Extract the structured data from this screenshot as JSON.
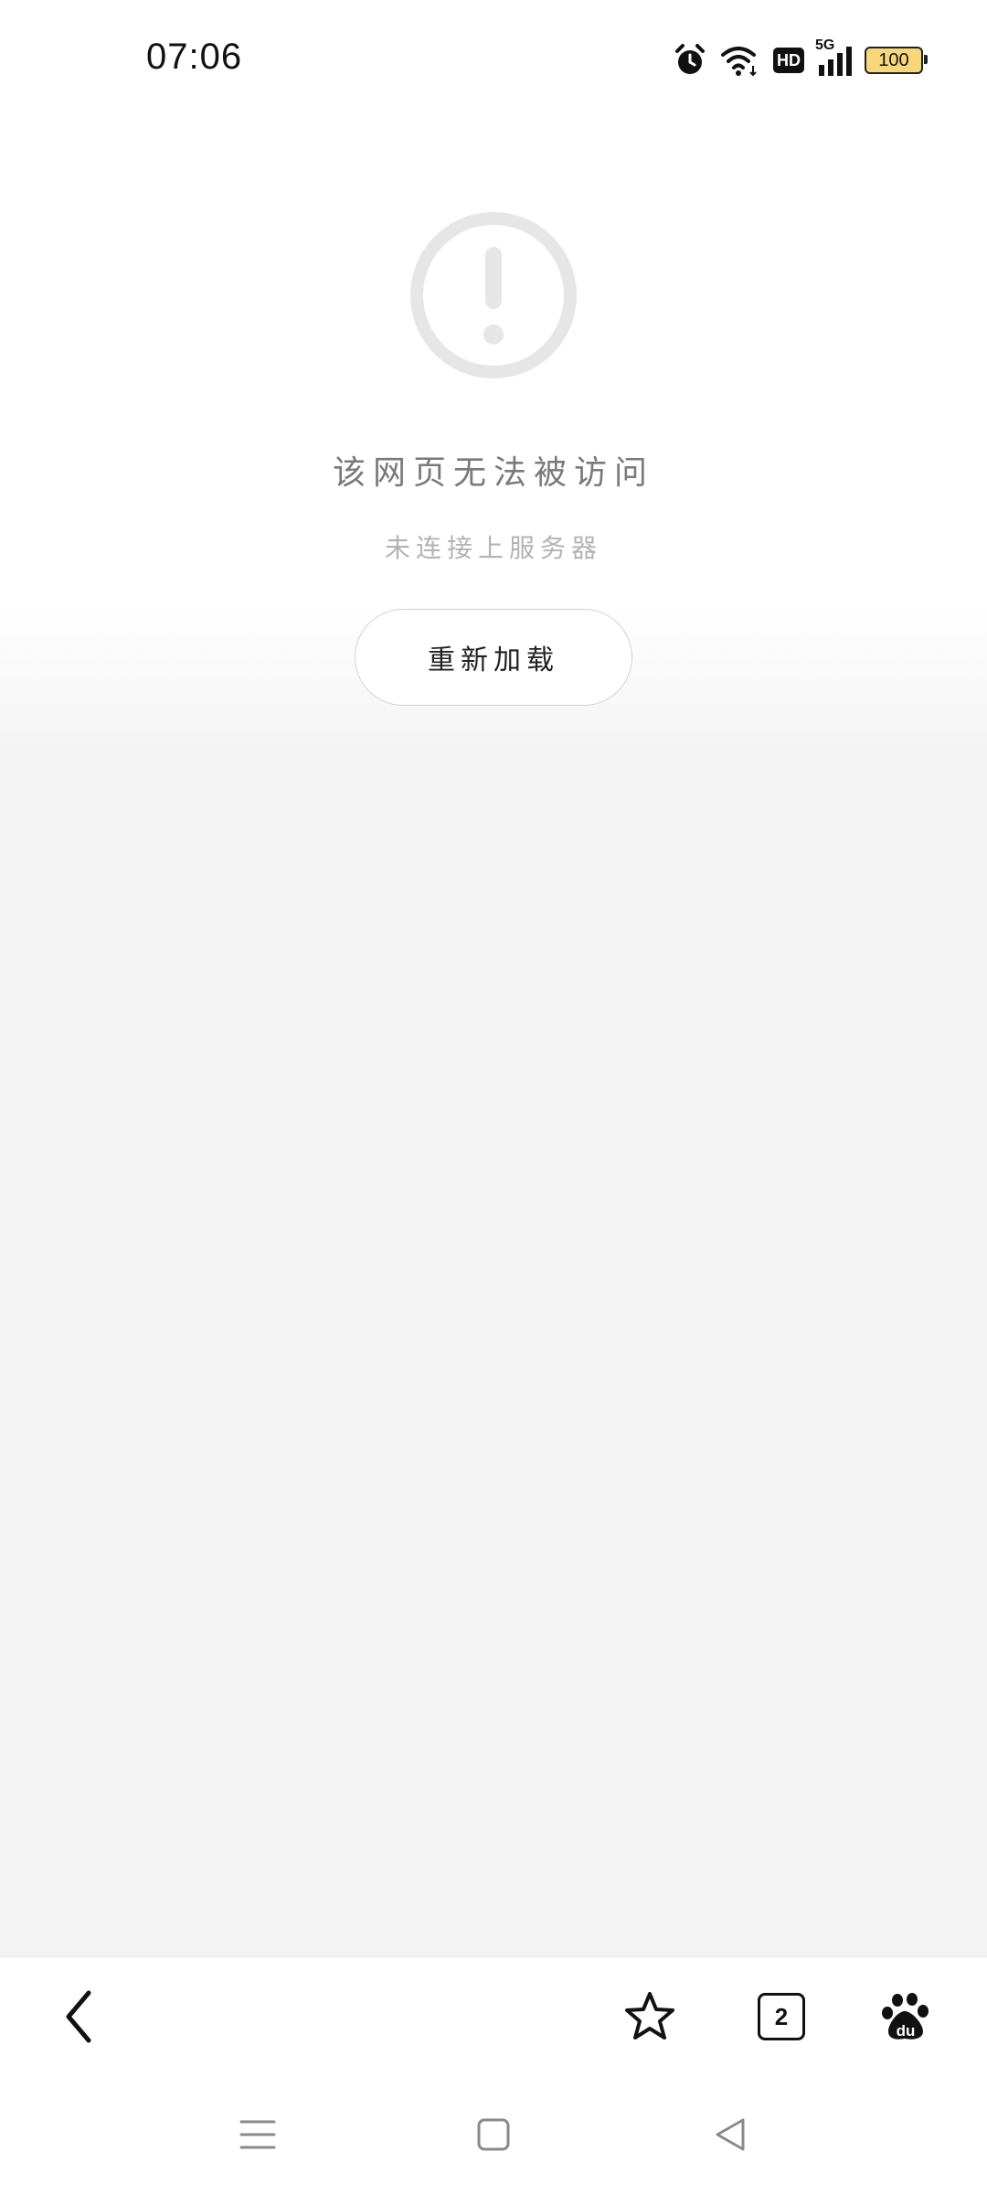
{
  "status_bar": {
    "time": "07:06",
    "icons": [
      "alarm-icon",
      "wifi-icon",
      "hd-icon",
      "5g-signal-icon",
      "battery-icon"
    ],
    "hd_label": "HD",
    "network_label": "5G",
    "battery_level": "100"
  },
  "error_page": {
    "icon": "exclamation-circle-icon",
    "title": "该网页无法被访问",
    "subtitle": "未连接上服务器",
    "reload_label": "重新加载"
  },
  "toolbar": {
    "back_icon": "back-chevron-icon",
    "bookmark_icon": "star-icon",
    "tab_count": "2",
    "baidu_icon": "baidu-paw-icon"
  },
  "nav_bar": {
    "icons": [
      "menu-icon",
      "home-icon",
      "back-triangle-icon"
    ]
  },
  "colors": {
    "icon_gray": "#e6e6e6",
    "title_text": "#7a7a7a",
    "subtitle_text": "#b3b3b3",
    "battery_fill": "#f7d77a"
  }
}
